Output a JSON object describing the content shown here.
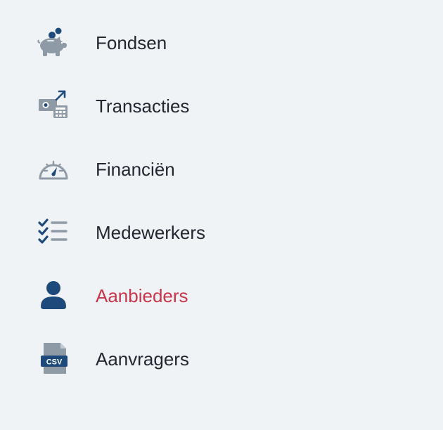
{
  "colors": {
    "background": "#f0f3f6",
    "text": "#222832",
    "active_text": "#c7364b",
    "icon_gray": "#8e9ba6",
    "icon_navy": "#1e4a7b"
  },
  "menu": {
    "items": [
      {
        "label": "Fondsen",
        "icon": "piggy-bank-icon",
        "active": false
      },
      {
        "label": "Transacties",
        "icon": "transactions-icon",
        "active": false
      },
      {
        "label": "Financiën",
        "icon": "speedometer-icon",
        "active": false
      },
      {
        "label": "Medewerkers",
        "icon": "checklist-icon",
        "active": false
      },
      {
        "label": "Aanbieders",
        "icon": "user-icon",
        "active": true
      },
      {
        "label": "Aanvragers",
        "icon": "csv-file-icon",
        "active": false
      }
    ],
    "csv_badge": "CSV"
  }
}
